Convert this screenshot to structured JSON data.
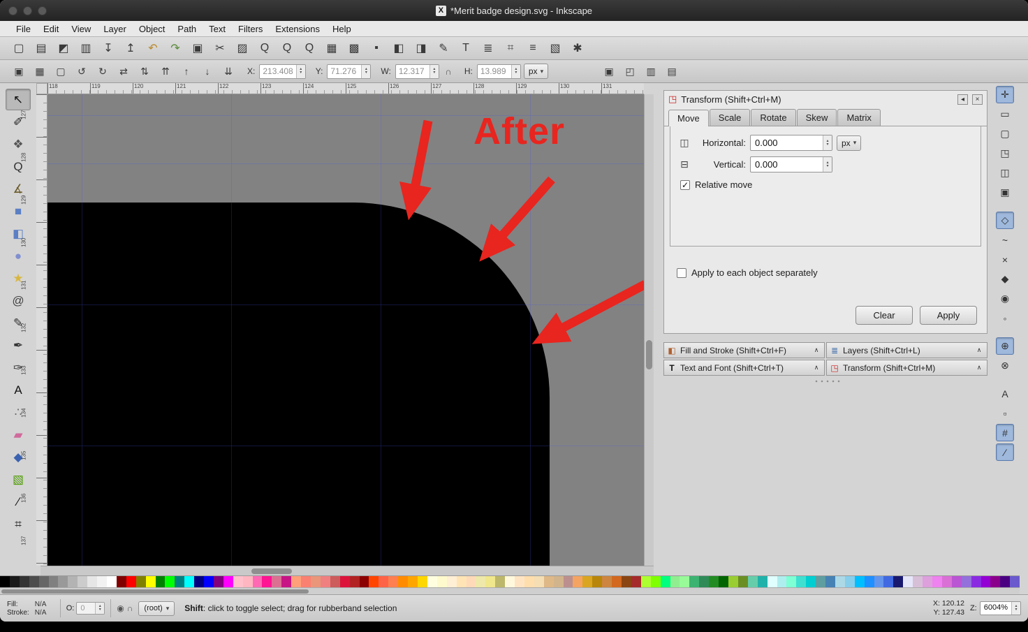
{
  "window": {
    "title": "*Merit badge design.svg - Inkscape",
    "icon": "X"
  },
  "menubar": {
    "items": [
      "File",
      "Edit",
      "View",
      "Layer",
      "Object",
      "Path",
      "Text",
      "Filters",
      "Extensions",
      "Help"
    ]
  },
  "command_toolbar": {
    "items": [
      {
        "name": "new-document-button",
        "glyph": "▢"
      },
      {
        "name": "open-document-button",
        "glyph": "▤"
      },
      {
        "name": "save-button",
        "glyph": "◩"
      },
      {
        "name": "print-button",
        "glyph": "▥"
      },
      {
        "name": "import-button",
        "glyph": "↧"
      },
      {
        "name": "export-button",
        "glyph": "↥"
      },
      {
        "name": "undo-button",
        "glyph": "↶",
        "color": "#b98a2e"
      },
      {
        "name": "redo-button",
        "glyph": "↷",
        "color": "#5a8a3a"
      },
      {
        "name": "copy-button",
        "glyph": "▣"
      },
      {
        "name": "cut-button",
        "glyph": "✂"
      },
      {
        "name": "paste-button",
        "glyph": "▨"
      },
      {
        "name": "zoom-drawing-button",
        "glyph": "Q"
      },
      {
        "name": "zoom-page-button",
        "glyph": "Q"
      },
      {
        "name": "zoom-selection-button",
        "glyph": "Q"
      },
      {
        "name": "duplicate-button",
        "glyph": "▦"
      },
      {
        "name": "clone-button",
        "glyph": "▩"
      },
      {
        "name": "unlink-clone-button",
        "glyph": "▪"
      },
      {
        "name": "group-button",
        "glyph": "◧"
      },
      {
        "name": "ungroup-button",
        "glyph": "◨"
      },
      {
        "name": "fill-stroke-dialog-button",
        "glyph": "✎"
      },
      {
        "name": "text-dialog-button",
        "glyph": "T"
      },
      {
        "name": "layers-dialog-button",
        "glyph": "≣"
      },
      {
        "name": "xml-editor-button",
        "glyph": "⌗"
      },
      {
        "name": "align-distribute-button",
        "glyph": "≡"
      },
      {
        "name": "document-properties-button",
        "glyph": "▧"
      },
      {
        "name": "preferences-button",
        "glyph": "✱"
      }
    ]
  },
  "tool_options": {
    "left_icons": [
      {
        "name": "select-all-button",
        "glyph": "▣"
      },
      {
        "name": "select-all-layers-button",
        "glyph": "▦"
      },
      {
        "name": "deselect-button",
        "glyph": "▢"
      },
      {
        "name": "rotate-ccw-button",
        "glyph": "↺"
      },
      {
        "name": "rotate-cw-button",
        "glyph": "↻"
      },
      {
        "name": "flip-horizontal-button",
        "glyph": "⇄"
      },
      {
        "name": "flip-vertical-button",
        "glyph": "⇅"
      },
      {
        "name": "raise-to-top-button",
        "glyph": "⇈"
      },
      {
        "name": "raise-button",
        "glyph": "↑"
      },
      {
        "name": "lower-button",
        "glyph": "↓"
      },
      {
        "name": "lower-to-bottom-button",
        "glyph": "⇊"
      }
    ],
    "x_label": "X:",
    "x_value": "213.408",
    "y_label": "Y:",
    "y_value": "71.276",
    "w_label": "W:",
    "w_value": "12.317",
    "h_label": "H:",
    "h_value": "13.989",
    "lock_glyph": "∩",
    "unit": "px",
    "right_toggles": [
      {
        "name": "transform-stroke-toggle",
        "glyph": "▣"
      },
      {
        "name": "transform-corners-toggle",
        "glyph": "◰"
      },
      {
        "name": "transform-gradient-toggle",
        "glyph": "▥"
      },
      {
        "name": "transform-pattern-toggle",
        "glyph": "▤"
      }
    ]
  },
  "toolbox": {
    "tools": [
      {
        "name": "select-tool",
        "glyph": "↖",
        "color": "#111111",
        "active": true
      },
      {
        "name": "node-tool",
        "glyph": "✐",
        "color": "#222222"
      },
      {
        "name": "tweak-tool",
        "glyph": "❖",
        "color": "#555555"
      },
      {
        "name": "zoom-tool",
        "glyph": "Q",
        "color": "#333333"
      },
      {
        "name": "measure-tool",
        "glyph": "∡",
        "color": "#6b5a2a"
      },
      {
        "name": "rectangle-tool",
        "glyph": "■",
        "color": "#5b7fc4"
      },
      {
        "name": "box3d-tool",
        "glyph": "◧",
        "color": "#5b7fc4"
      },
      {
        "name": "ellipse-tool",
        "glyph": "●",
        "color": "#7f8fd0"
      },
      {
        "name": "star-tool",
        "glyph": "★",
        "color": "#d8b640"
      },
      {
        "name": "spiral-tool",
        "glyph": "@",
        "color": "#444444"
      },
      {
        "name": "pencil-tool",
        "glyph": "✎",
        "color": "#333333"
      },
      {
        "name": "pen-tool",
        "glyph": "✒",
        "color": "#333333"
      },
      {
        "name": "calligraphy-tool",
        "glyph": "✑",
        "color": "#333333"
      },
      {
        "name": "text-tool",
        "glyph": "A",
        "color": "#111111"
      },
      {
        "name": "spray-tool",
        "glyph": "∴",
        "color": "#666666"
      },
      {
        "name": "eraser-tool",
        "glyph": "▰",
        "color": "#d06a9c"
      },
      {
        "name": "paint-bucket-tool",
        "glyph": "◆",
        "color": "#3a62b0"
      },
      {
        "name": "gradient-tool",
        "glyph": "▧",
        "color": "#4e9a06"
      },
      {
        "name": "dropper-tool",
        "glyph": "∕",
        "color": "#111111"
      },
      {
        "name": "connector-tool",
        "glyph": "⌗",
        "color": "#333333"
      }
    ]
  },
  "rulers": {
    "top_labels": [
      "118",
      "119",
      "120",
      "121",
      "122",
      "123",
      "124",
      "125",
      "126",
      "127",
      "128",
      "129",
      "130",
      "131"
    ],
    "left_labels": [
      "127",
      "128",
      "129",
      "130",
      "131",
      "132",
      "133",
      "134",
      "135",
      "136",
      "137"
    ]
  },
  "canvas": {
    "after_label": "After",
    "annotation_color": "#e8251f",
    "background": "#828282",
    "shape_color": "#000000"
  },
  "transform_panel": {
    "title": "Transform (Shift+Ctrl+M)",
    "icon_glyph": "◳",
    "iconify_glyph": "◂",
    "close_glyph": "×",
    "tabs": [
      "Move",
      "Scale",
      "Rotate",
      "Skew",
      "Matrix"
    ],
    "active_tab": "Move",
    "horizontal_icon": "◫",
    "horizontal_label": "Horizontal:",
    "horizontal_value": "0.000",
    "vertical_icon": "⊟",
    "vertical_label": "Vertical:",
    "vertical_value": "0.000",
    "unit": "px",
    "relative_move_label": "Relative move",
    "relative_move_check": "✓",
    "apply_each_label": "Apply to each object separately",
    "clear_label": "Clear",
    "apply_label": "Apply"
  },
  "docked_panels": [
    {
      "title": "Fill and Stroke (Shift+Ctrl+F)",
      "icon": "◧",
      "icon_color": "#b06030"
    },
    {
      "title": "Layers (Shift+Ctrl+L)",
      "icon": "≣",
      "icon_color": "#3465a4"
    },
    {
      "title": "Text and Font (Shift+Ctrl+T)",
      "icon": "T",
      "icon_color": "#111111"
    },
    {
      "title": "Transform (Shift+Ctrl+M)",
      "icon": "◳",
      "icon_color": "#cc2222"
    }
  ],
  "snap_toolbar": {
    "items": [
      {
        "name": "snap-toggle",
        "glyph": "✛",
        "active": true
      },
      {
        "name": "snap-bbox",
        "glyph": "▭"
      },
      {
        "name": "snap-bbox-edges",
        "glyph": "▢"
      },
      {
        "name": "snap-bbox-corners",
        "glyph": "◳"
      },
      {
        "name": "snap-bbox-edge-midpoints",
        "glyph": "◫"
      },
      {
        "name": "snap-bbox-centers",
        "glyph": "▣"
      },
      {
        "name": "snap-nodes",
        "glyph": "◇",
        "active": true,
        "gap": true
      },
      {
        "name": "snap-paths",
        "glyph": "~"
      },
      {
        "name": "snap-path-intersections",
        "glyph": "×"
      },
      {
        "name": "snap-cusp-nodes",
        "glyph": "◆"
      },
      {
        "name": "snap-smooth-nodes",
        "glyph": "◉"
      },
      {
        "name": "snap-midpoints",
        "glyph": "◦"
      },
      {
        "name": "snap-object-centers",
        "glyph": "⊕",
        "active": true,
        "gap": true
      },
      {
        "name": "snap-rotation-centers",
        "glyph": "⊗"
      },
      {
        "name": "snap-text-baseline",
        "glyph": "A",
        "gap": true
      },
      {
        "name": "snap-page-border",
        "glyph": "▫"
      },
      {
        "name": "snap-grids",
        "glyph": "#",
        "active": true
      },
      {
        "name": "snap-guides",
        "glyph": "∕",
        "active": true
      }
    ]
  },
  "palette": {
    "colors": [
      "#000000",
      "#1a1a1a",
      "#333333",
      "#4d4d4d",
      "#666666",
      "#808080",
      "#999999",
      "#b3b3b3",
      "#cccccc",
      "#e6e6e6",
      "#f2f2f2",
      "#ffffff",
      "#800000",
      "#ff0000",
      "#808000",
      "#ffff00",
      "#008000",
      "#00ff00",
      "#008080",
      "#00ffff",
      "#000080",
      "#0000ff",
      "#800080",
      "#ff00ff",
      "#ffc0cb",
      "#ffb6c1",
      "#ff69b4",
      "#ff1493",
      "#db7093",
      "#c71585",
      "#ffa07a",
      "#fa8072",
      "#e9967a",
      "#f08080",
      "#cd5c5c",
      "#dc143c",
      "#b22222",
      "#8b0000",
      "#ff4500",
      "#ff6347",
      "#ff7f50",
      "#ff8c00",
      "#ffa500",
      "#ffd700",
      "#ffffe0",
      "#fffacd",
      "#ffefd5",
      "#ffe4b5",
      "#ffdab9",
      "#eee8aa",
      "#f0e68c",
      "#bdb76b",
      "#fff8dc",
      "#ffe4c4",
      "#ffdead",
      "#f5deb3",
      "#deb887",
      "#d2b48c",
      "#bc8f8f",
      "#f4a460",
      "#daa520",
      "#b8860b",
      "#cd853f",
      "#d2691e",
      "#8b4513",
      "#a52a2a",
      "#adff2f",
      "#7fff00",
      "#00ff7f",
      "#90ee90",
      "#98fb98",
      "#3cb371",
      "#2e8b57",
      "#228b22",
      "#006400",
      "#9acd32",
      "#6b8e23",
      "#66cdaa",
      "#20b2aa",
      "#e0ffff",
      "#afeeee",
      "#7fffd4",
      "#40e0d0",
      "#00ced1",
      "#5f9ea0",
      "#4682b4",
      "#add8e6",
      "#87ceeb",
      "#00bfff",
      "#1e90ff",
      "#6495ed",
      "#4169e1",
      "#191970",
      "#e6e6fa",
      "#d8bfd8",
      "#dda0dd",
      "#ee82ee",
      "#da70d6",
      "#ba55d3",
      "#9370db",
      "#8a2be2",
      "#9400d3",
      "#8b008b",
      "#4b0082",
      "#6a5acd"
    ]
  },
  "statusbar": {
    "fill_label": "Fill:",
    "fill_value": "N/A",
    "stroke_label": "Stroke:",
    "stroke_value": "N/A",
    "opacity_label": "O:",
    "opacity_value": "0",
    "visibility_glyph": "◉",
    "lock_glyph": "∩",
    "layer_value": "(root)",
    "message_bold": "Shift",
    "message_rest": ": click to toggle select; drag for rubberband selection",
    "x_label": "X:",
    "x_value": "120.12",
    "y_label": "Y:",
    "y_value": "127.43",
    "z_label": "Z:",
    "zoom_value": "6004%"
  }
}
